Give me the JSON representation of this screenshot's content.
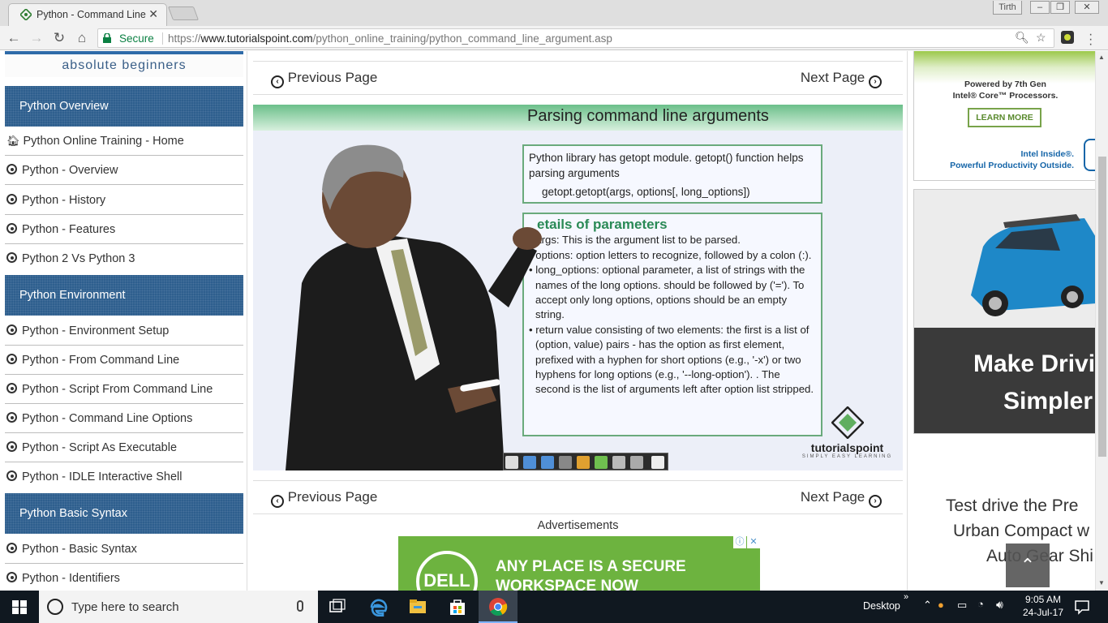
{
  "browser": {
    "tab_title": "Python - Command Line",
    "profile_name": "Tirth",
    "secure_label": "Secure",
    "url_scheme": "https://",
    "url_host": "www.tutorialspoint.com",
    "url_path": "/python_online_training/python_command_line_argument.asp"
  },
  "sidebar": {
    "banner_text": "absolute beginners",
    "sections": [
      {
        "title": "Python Overview",
        "items": [
          "Python Online Training - Home",
          "Python - Overview",
          "Python - History",
          "Python - Features",
          "Python 2 Vs Python 3"
        ]
      },
      {
        "title": "Python Environment",
        "items": [
          "Python - Environment Setup",
          "Python - From Command Line",
          "Python - Script From Command Line",
          "Python - Command Line Options",
          "Python - Script As Executable",
          "Python - IDLE Interactive Shell"
        ]
      },
      {
        "title": "Python Basic Syntax",
        "items": [
          "Python - Basic Syntax",
          "Python - Identifiers"
        ]
      }
    ]
  },
  "main": {
    "prev_label": "Previous Page",
    "next_label": "Next Page",
    "ads_label": "Advertisements",
    "video": {
      "slide_title": "Parsing command line arguments",
      "box1_text": "Python library has getopt module. getopt() function helps parsing arguments",
      "box1_code": "getopt.getopt(args, options[, long_options])",
      "box2_heading": "etails of parameters",
      "box2_bullets": [
        "args: This is the argument list to be parsed.",
        "options: option letters to recognize, followed by a colon (:).",
        "long_options: optional parameter, a list of strings with the names of the long options. should be followed by ('='). To accept only long options, options should be an empty string.",
        "return value consisting of two elements: the first is a list of (option, value) pairs - has the option as first element, prefixed with a hyphen for short options (e.g., '-x') or two hyphens for long options (e.g., '--long-option'). . The second is the list of arguments left after option list stripped."
      ],
      "logo_name": "tutorialspoint",
      "logo_tagline": "SIMPLY EASY LEARNING"
    },
    "dell_ad": {
      "logo": "DELL",
      "line1": "ANY PLACE IS A SECURE",
      "line2": "WORKSPACE NOW"
    }
  },
  "right_ads": {
    "intel_line1": "Powered by 7th Gen",
    "intel_line2": "Intel® Core™ Processors.",
    "intel_button": "LEARN MORE",
    "intel_tag1": "Intel Inside®.",
    "intel_tag2": "Powerful Productivity Outside.",
    "car_line1": "Make Drivi",
    "car_line2": "Simpler",
    "testdrive_line1": "Test drive the Pre",
    "testdrive_line2": "Urban Compact w",
    "testdrive_line3": "Auto Gear Shi"
  },
  "taskbar": {
    "search_placeholder": "Type here to search",
    "desktop_label": "Desktop",
    "time": "9:05 AM",
    "date": "24-Jul-17"
  },
  "colors": {
    "sidebar_header": "#2e5f8e",
    "secure_green": "#0b8043",
    "taskbar": "#101820",
    "dell_green": "#6db33f"
  }
}
